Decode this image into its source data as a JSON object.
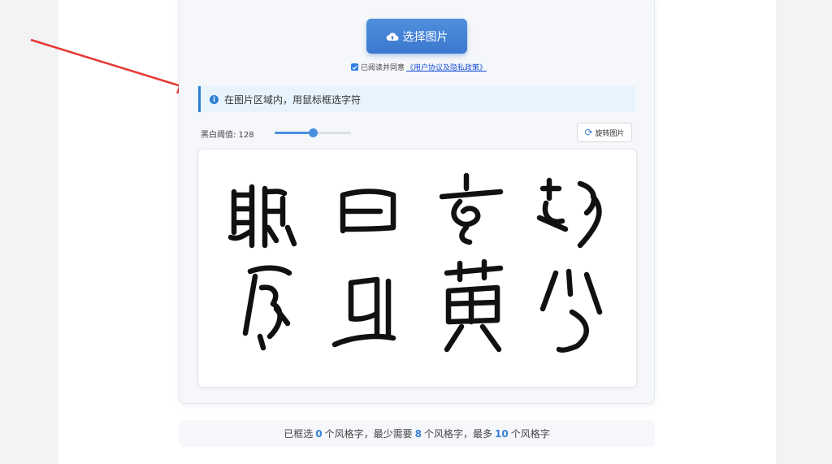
{
  "upload": {
    "label": "选择图片",
    "icon": "cloud-upload-icon"
  },
  "agreement": {
    "checked": true,
    "prefix": "已阅读并同意",
    "link": "《用户协议及隐私政策》"
  },
  "info": {
    "icon": "info-icon",
    "text": "在图片区域内，用鼠标框选字符"
  },
  "threshold": {
    "label": "黑白阈值: 128",
    "value": 128,
    "max": 255
  },
  "rotate": {
    "label": "旋转图片",
    "icon": "rotate-icon"
  },
  "status": {
    "t1": "已框选",
    "selected": "0",
    "t2": "个风格字，最少需要",
    "min": "8",
    "t3": "个风格字，最多",
    "max": "10",
    "t4": "个风格字"
  },
  "colors": {
    "accent": "#3b78cf",
    "info_bg": "#e8f4fd",
    "annotation_arrow": "#e53935"
  }
}
